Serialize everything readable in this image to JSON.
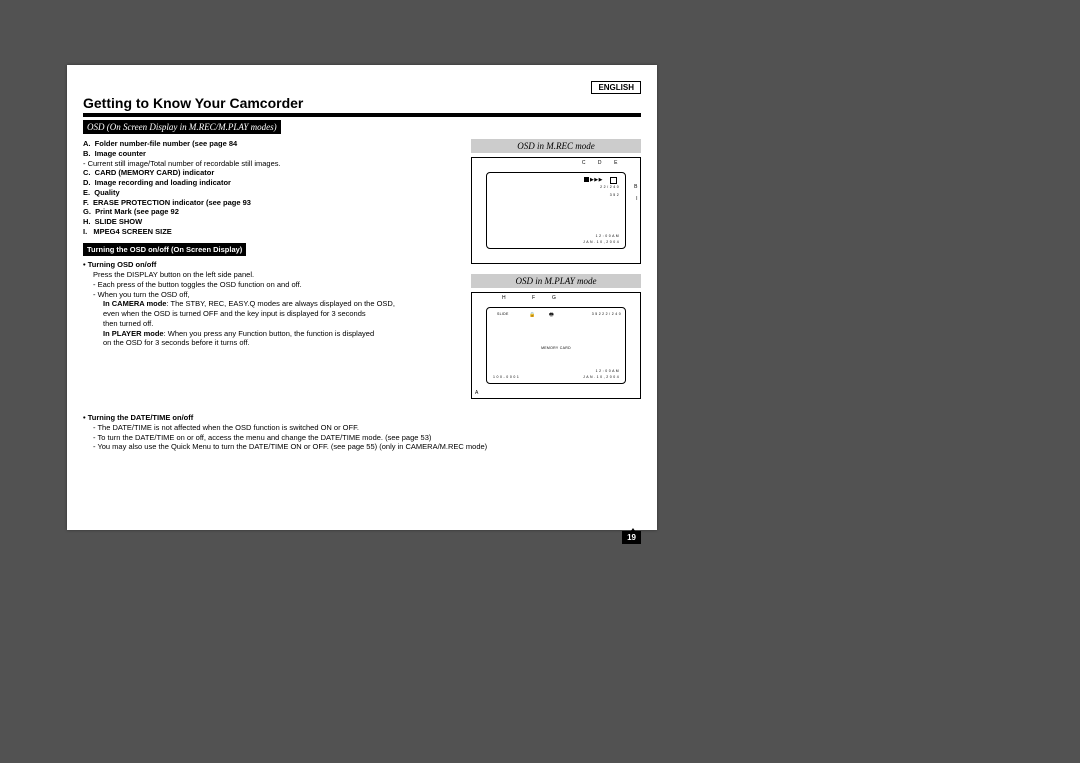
{
  "lang_label": "ENGLISH",
  "title": "Getting to Know Your Camcorder",
  "subtitle": "OSD (On Screen Display in M.REC/M.PLAY modes)",
  "items": {
    "A": "Folder number-file number (see page 84",
    "B": "Image counter",
    "B_sub": "- Current still image/Total number of recordable still images.",
    "C": "CARD (MEMORY CARD) indicator",
    "D": "Image recording and loading indicator",
    "E": "Quality",
    "F": "ERASE PROTECTION indicator (see page 93",
    "G": "Print Mark (see page 92",
    "H": "SLIDE SHOW",
    "I": "MPEG4 SCREEN SIZE"
  },
  "blackbox_label": "Turning the OSD on/off (On Screen Display)",
  "section1": {
    "heading": "Turning OSD on/off",
    "line1": "Press the DISPLAY button on the left side panel.",
    "line2": "- Each press of the button toggles the OSD function on and off.",
    "line3": "- When you turn the OSD off,",
    "line4a": "In CAMERA mode",
    "line4b": ": The STBY, REC, EASY.Q modes are always displayed on the OSD,",
    "line5": "even when the OSD is turned OFF and the key input is displayed for 3 seconds",
    "line6": "then turned off.",
    "line7a": "In PLAYER mode",
    "line7b": ": When you press any Function button, the function is displayed",
    "line8": "on the OSD for 3 seconds before it turns off."
  },
  "section2": {
    "heading": "Turning the DATE/TIME on/off",
    "line1": "- The DATE/TIME is not affected when the OSD function is switched ON or OFF.",
    "line2": "- To turn the DATE/TIME on or off, access the menu and change the DATE/TIME mode. (see page 53)",
    "line3": "- You may also use the Quick Menu to turn the DATE/TIME ON or OFF. (see page 55) (only in CAMERA/M.REC mode)"
  },
  "diagram1": {
    "title": "OSD in M.REC mode",
    "labels": {
      "B": "B",
      "C": "C",
      "D": "D",
      "E": "E",
      "I": "I"
    },
    "text": {
      "count": "2 2 / 2 4 0",
      "size": "3 5 2",
      "time": "1 2 : 0 0 A M",
      "date": "J A N . 1 0 , 2 0 0 4"
    }
  },
  "diagram2": {
    "title": "OSD in M.PLAY mode",
    "labels": {
      "A": "A",
      "F": "F",
      "G": "G",
      "H": "H"
    },
    "text": {
      "slide": "SLIDE",
      "size": "3 5 2",
      "count": "2 2 / 2 4 0",
      "card": "MEMORY CARD",
      "folder": "1 0 0 - 0 0 0 1",
      "time": "1 2 : 0 0 A M",
      "date": "J A N . 1 0 , 2 0 0 4"
    }
  },
  "page_number": "19"
}
